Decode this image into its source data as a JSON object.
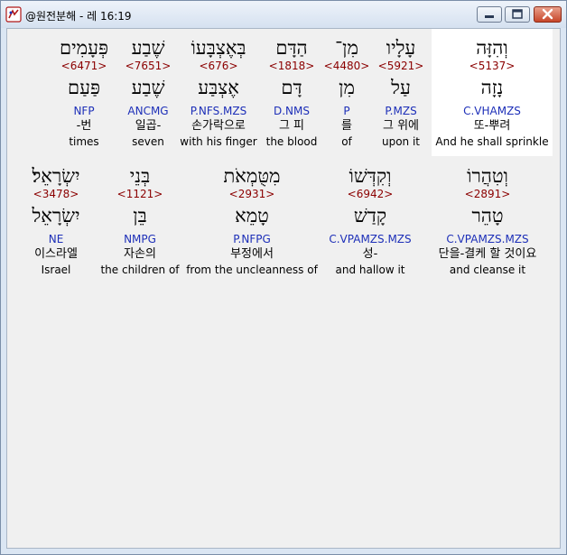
{
  "window": {
    "title": "@원전분해 - 레 16:19"
  },
  "rows": [
    {
      "words": [
        {
          "hebrew": "וְהִזָּה",
          "strong": "<5137>",
          "lemma": "נָזָה",
          "parse": "C.VHAMZS",
          "korean": "또-뿌려",
          "english": "And he shall sprinkle",
          "highlighted": true
        },
        {
          "hebrew": "עָלָיו",
          "strong": "<5921>",
          "lemma": "עַל",
          "parse": "P.MZS",
          "korean": "그 위에",
          "english": "upon it",
          "highlighted": false
        },
        {
          "hebrew": "מִן־",
          "strong": "<4480>",
          "lemma": "מִן",
          "parse": "P",
          "korean": "를",
          "english": "of",
          "highlighted": false
        },
        {
          "hebrew": "הַדָּם",
          "strong": "<1818>",
          "lemma": "דָּם",
          "parse": "D.NMS",
          "korean": "그 피",
          "english": "the blood",
          "highlighted": false
        },
        {
          "hebrew": "בְּאֶצְבָּעוֹ",
          "strong": "<676>",
          "lemma": "אֶצְבַּע",
          "parse": "P.NFS.MZS",
          "korean": "손가락으로",
          "english": "with his finger",
          "highlighted": false
        },
        {
          "hebrew": "שֶׁבַע",
          "strong": "<7651>",
          "lemma": "שֶׁבַע",
          "parse": "ANCMG",
          "korean": "일곱-",
          "english": "seven",
          "highlighted": false
        },
        {
          "hebrew": "פְּעָמִים",
          "strong": "<6471>",
          "lemma": "פַּעַם",
          "parse": "NFP",
          "korean": "-번",
          "english": "times",
          "highlighted": false
        }
      ]
    },
    {
      "words": [
        {
          "hebrew": "וְטִהֲרוֹ",
          "strong": "<2891>",
          "lemma": "טָהֵר",
          "parse": "C.VPAMZS.MZS",
          "korean": "단을-결케 할 것이요",
          "english": "and cleanse it",
          "highlighted": false
        },
        {
          "hebrew": "וְקִדְּשׁוֹ",
          "strong": "<6942>",
          "lemma": "קָדַשׁ",
          "parse": "C.VPAMZS.MZS",
          "korean": "성-",
          "english": "and hallow it",
          "highlighted": false
        },
        {
          "hebrew": "מִטֻּמְאֹת",
          "strong": "<2931>",
          "lemma": "טָמֵא",
          "parse": "P.NFPG",
          "korean": "부정에서",
          "english": "from the uncleanness of",
          "highlighted": false
        },
        {
          "hebrew": "בְּנֵי",
          "strong": "<1121>",
          "lemma": "בֵּן",
          "parse": "NMPG",
          "korean": "자손의",
          "english": "the children of",
          "highlighted": false
        },
        {
          "hebrew": "יִשְׂרָאֵל׃",
          "strong": "<3478>",
          "lemma": "יִשְׂרָאֵל",
          "parse": "NE",
          "korean": "이스라엘",
          "english": "Israel",
          "highlighted": false
        }
      ]
    }
  ]
}
